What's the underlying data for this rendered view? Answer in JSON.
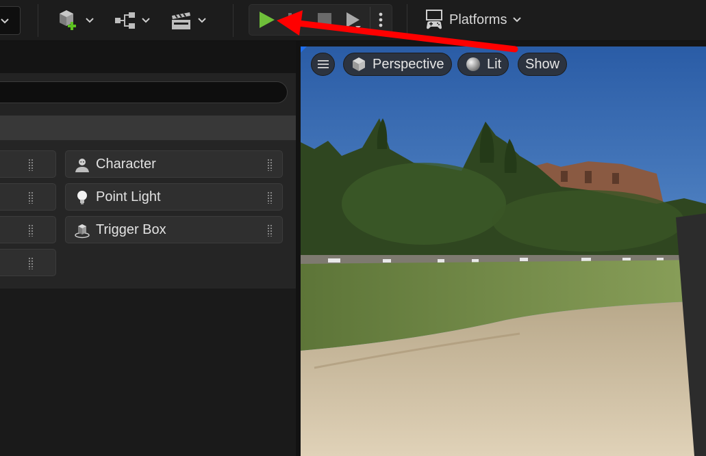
{
  "toolbar": {
    "icons": [
      "chevron-down-icon",
      "add-actor-icon",
      "blueprint-graph-icon",
      "cinematics-clapper-icon"
    ],
    "play_controls": [
      "play-icon",
      "pause-icon",
      "stop-icon",
      "skip-icon",
      "more-options-icon"
    ],
    "platforms_label": "Platforms",
    "colors": {
      "play": "#6fbf3a",
      "add_plus": "#5cc21f",
      "background": "#1c1c1c"
    }
  },
  "place_actors": {
    "items": [
      {
        "label": "",
        "icon": ""
      },
      {
        "label": "Character",
        "icon": "character-icon"
      },
      {
        "label": "",
        "icon": ""
      },
      {
        "label": "Point Light",
        "icon": "point-light-icon"
      },
      {
        "label": "",
        "icon": ""
      },
      {
        "label": "Trigger Box",
        "icon": "trigger-box-icon"
      },
      {
        "label": "",
        "icon": ""
      }
    ]
  },
  "viewport": {
    "menu_icon": "hamburger-menu-icon",
    "view_mode": "Perspective",
    "lighting_mode": "Lit",
    "show_label": "Show"
  },
  "annotation": {
    "arrow_color": "#ff0000"
  }
}
